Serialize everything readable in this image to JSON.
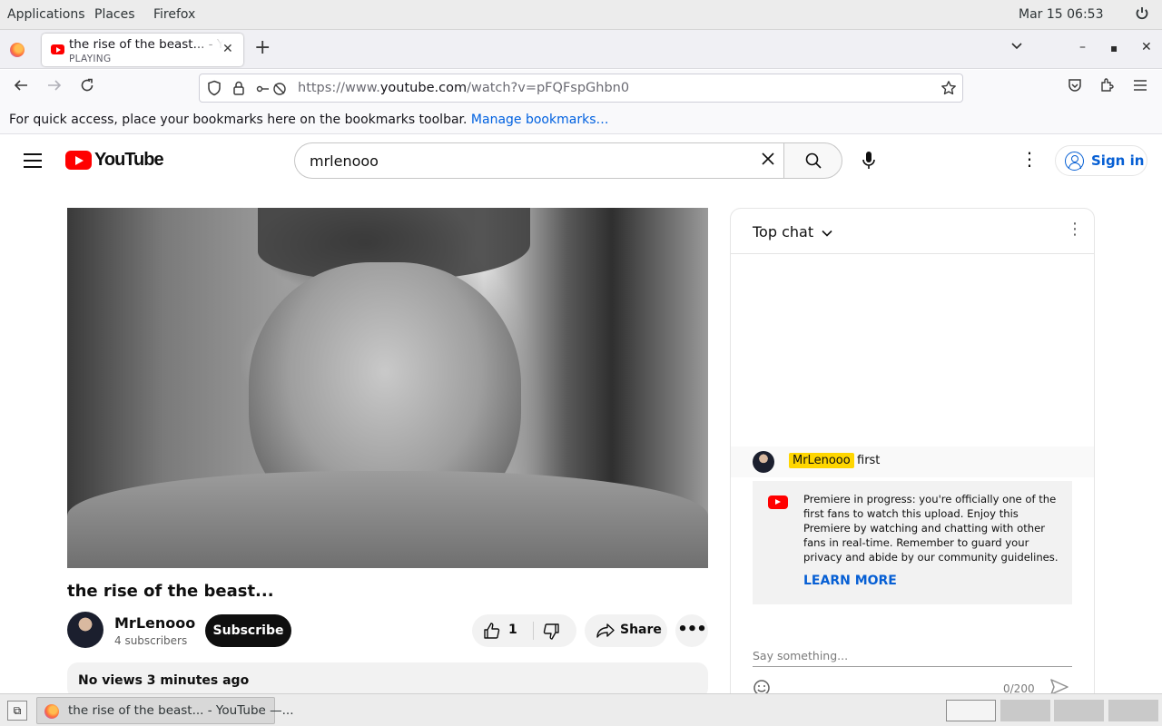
{
  "system_bar": {
    "menus": [
      "Applications",
      "Places",
      "Firefox"
    ],
    "clock": "Mar 15  06:53"
  },
  "browser": {
    "tab": {
      "title": "the rise of the beast... - YouTube",
      "status": "PLAYING"
    },
    "url_prefix": "https://www.",
    "url_host": "youtube.com",
    "url_path": "/watch?v=pFQFspGhbn0",
    "bookmarks_hint": "For quick access, place your bookmarks here on the bookmarks toolbar.",
    "bookmarks_link": "Manage bookmarks…"
  },
  "youtube": {
    "logo_text": "YouTube",
    "search_query": "mrlenooo",
    "sign_in": "Sign in",
    "video": {
      "title": "the rise of the beast...",
      "channel": "MrLenooo",
      "subscribers": "4 subscribers",
      "subscribe_label": "Subscribe",
      "likes": "1",
      "share_label": "Share",
      "meta": "No views  3 minutes ago"
    },
    "chat": {
      "header": "Top chat",
      "message": {
        "author": "MrLenooo",
        "text": "first"
      },
      "notice": "Premiere in progress: you're officially one of the first fans to watch this upload. Enjoy this Premiere by watching and chatting with other fans in real-time. Remember to guard your privacy and abide by our community guidelines.",
      "learn_more": "LEARN MORE",
      "input_placeholder": "Say something...",
      "counter": "0/200"
    }
  },
  "taskbar": {
    "task_label": "the rise of the beast... - YouTube —..."
  },
  "colors": {
    "youtube_red": "#ff0000",
    "link_blue": "#065fd4",
    "author_highlight": "#ffd600"
  }
}
